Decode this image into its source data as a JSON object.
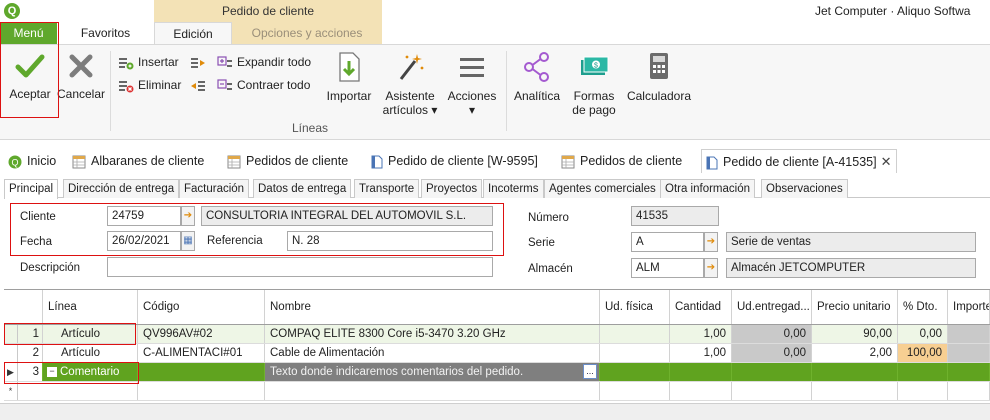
{
  "app": {
    "window_title": "Jet Computer · Aliquo Softwa",
    "context_group": "Pedido de cliente",
    "logo_letter": "Q"
  },
  "ribbon_tabs": {
    "menu": "Menú",
    "favoritos": "Favoritos",
    "edicion": "Edición",
    "opciones": "Opciones y acciones"
  },
  "ribbon": {
    "aceptar": "Aceptar",
    "cancelar": "Cancelar",
    "insertar": "Insertar",
    "eliminar": "Eliminar",
    "expandir": "Expandir todo",
    "contraer": "Contraer todo",
    "importar": "Importar",
    "asistente_1": "Asistente",
    "asistente_2": "artículos ▾",
    "acciones_1": "Acciones",
    "acciones_2": "▾",
    "analitica": "Analítica",
    "formas_1": "Formas",
    "formas_2": "de pago",
    "calculadora": "Calculadora",
    "group_lineas": "Líneas"
  },
  "doc_tabs": [
    {
      "label": "Inicio"
    },
    {
      "label": "Albaranes de cliente"
    },
    {
      "label": "Pedidos de cliente"
    },
    {
      "label": "Pedido de cliente [W-9595]"
    },
    {
      "label": "Pedidos de cliente"
    },
    {
      "label": "Pedido de cliente [A-41535]"
    }
  ],
  "close_glyph": "✕",
  "sub_tabs": [
    "Principal",
    "Dirección de entrega",
    "Facturación",
    "Datos de entrega",
    "Transporte",
    "Proyectos",
    "Incoterms",
    "Agentes comerciales",
    "Otra información",
    "Observaciones"
  ],
  "form": {
    "cliente_label": "Cliente",
    "cliente_code": "24759",
    "cliente_name": "CONSULTORIA INTEGRAL DEL AUTOMOVIL S.L.",
    "fecha_label": "Fecha",
    "fecha_value": "26/02/2021",
    "referencia_label": "Referencia",
    "referencia_value": "N. 28",
    "descripcion_label": "Descripción",
    "descripcion_value": "",
    "numero_label": "Número",
    "numero_value": "41535",
    "serie_label": "Serie",
    "serie_code": "A",
    "serie_name": "Serie de ventas",
    "almacen_label": "Almacén",
    "almacen_code": "ALM",
    "almacen_name": "Almacén JETCOMPUTER"
  },
  "grid": {
    "headers": {
      "linea": "Línea",
      "codigo": "Código",
      "nombre": "Nombre",
      "ud_fisica": "Ud. física",
      "cantidad": "Cantidad",
      "ud_entregadas": "Ud.entregad...",
      "precio": "Precio unitario",
      "dto": "% Dto.",
      "importe": "Importe"
    },
    "rows": [
      {
        "n": "1",
        "tipo": "Artículo",
        "codigo": "QV996AV#02",
        "nombre": "COMPAQ ELITE 8300 Core i5-3470 3.20 GHz",
        "ud_fisica": "",
        "cantidad": "1,00",
        "ud_entregadas": "0,00",
        "precio": "90,00",
        "dto": "0,00"
      },
      {
        "n": "2",
        "tipo": "Artículo",
        "codigo": "C-ALIMENTACI#01",
        "nombre": "Cable de Alimentación",
        "ud_fisica": "",
        "cantidad": "1,00",
        "ud_entregadas": "0,00",
        "precio": "2,00",
        "dto": "100,00"
      },
      {
        "n": "3",
        "tipo": "Comentario",
        "codigo": "",
        "nombre": "Texto donde indicaremos comentarios del pedido.",
        "ud_fisica": "",
        "cantidad": "",
        "ud_entregadas": "",
        "precio": "",
        "dto": ""
      }
    ],
    "new_row_marker": "*",
    "current_row_marker": "▶",
    "collapse_glyph": "−",
    "ellipsis": "..."
  },
  "colors": {
    "accent_green": "#5fa82c",
    "selected_row": "#60a31f",
    "context_tab": "#f3e2b6",
    "highlight_outline": "#dd1111",
    "discount_cell": "#f7cf92"
  }
}
